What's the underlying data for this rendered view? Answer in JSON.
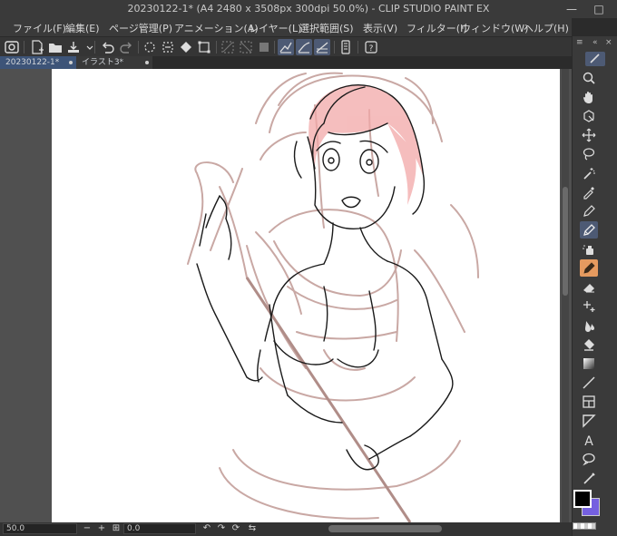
{
  "window": {
    "title": "20230122-1* (A4 2480 x 3508px 300dpi 50.0%) - CLIP STUDIO PAINT EX",
    "minimize": "—",
    "restore": "□"
  },
  "menu": [
    "ファイル(F)",
    "編集(E)",
    "ページ管理(P)",
    "アニメーション(A)",
    "レイヤー(L)",
    "選択範囲(S)",
    "表示(V)",
    "フィルター(I)",
    "ウィンドウ(W)",
    "ヘルプ(H)"
  ],
  "tabs": [
    {
      "label": "20230122-1*",
      "active": true
    },
    {
      "label": "イラスト3*",
      "active": false
    }
  ],
  "status": {
    "zoom": "50.0",
    "rotation": "0.0",
    "minus": "−",
    "plus": "+"
  },
  "colors": {
    "main": "#000000",
    "sub": "#7560e0",
    "selection_highlight": "#4d5a74",
    "active_tool": "#e59a5f",
    "rough_sketch": "#c9a8a4",
    "hair_tint": "#f2a8a8"
  },
  "tools": [
    "magnifier-icon",
    "hand-icon",
    "rotate-icon",
    "move-icon",
    "lasso-icon",
    "wand-icon",
    "eyedropper-icon",
    "pen-icon",
    "pencil-icon",
    "brush-icon",
    "airbrush-icon",
    "eraser-icon",
    "decoration-icon",
    "blend-icon",
    "fill-icon",
    "gradient-icon",
    "line-icon",
    "frame-icon",
    "ruler-icon",
    "text-icon",
    "balloon-icon",
    "correct-line-icon"
  ]
}
